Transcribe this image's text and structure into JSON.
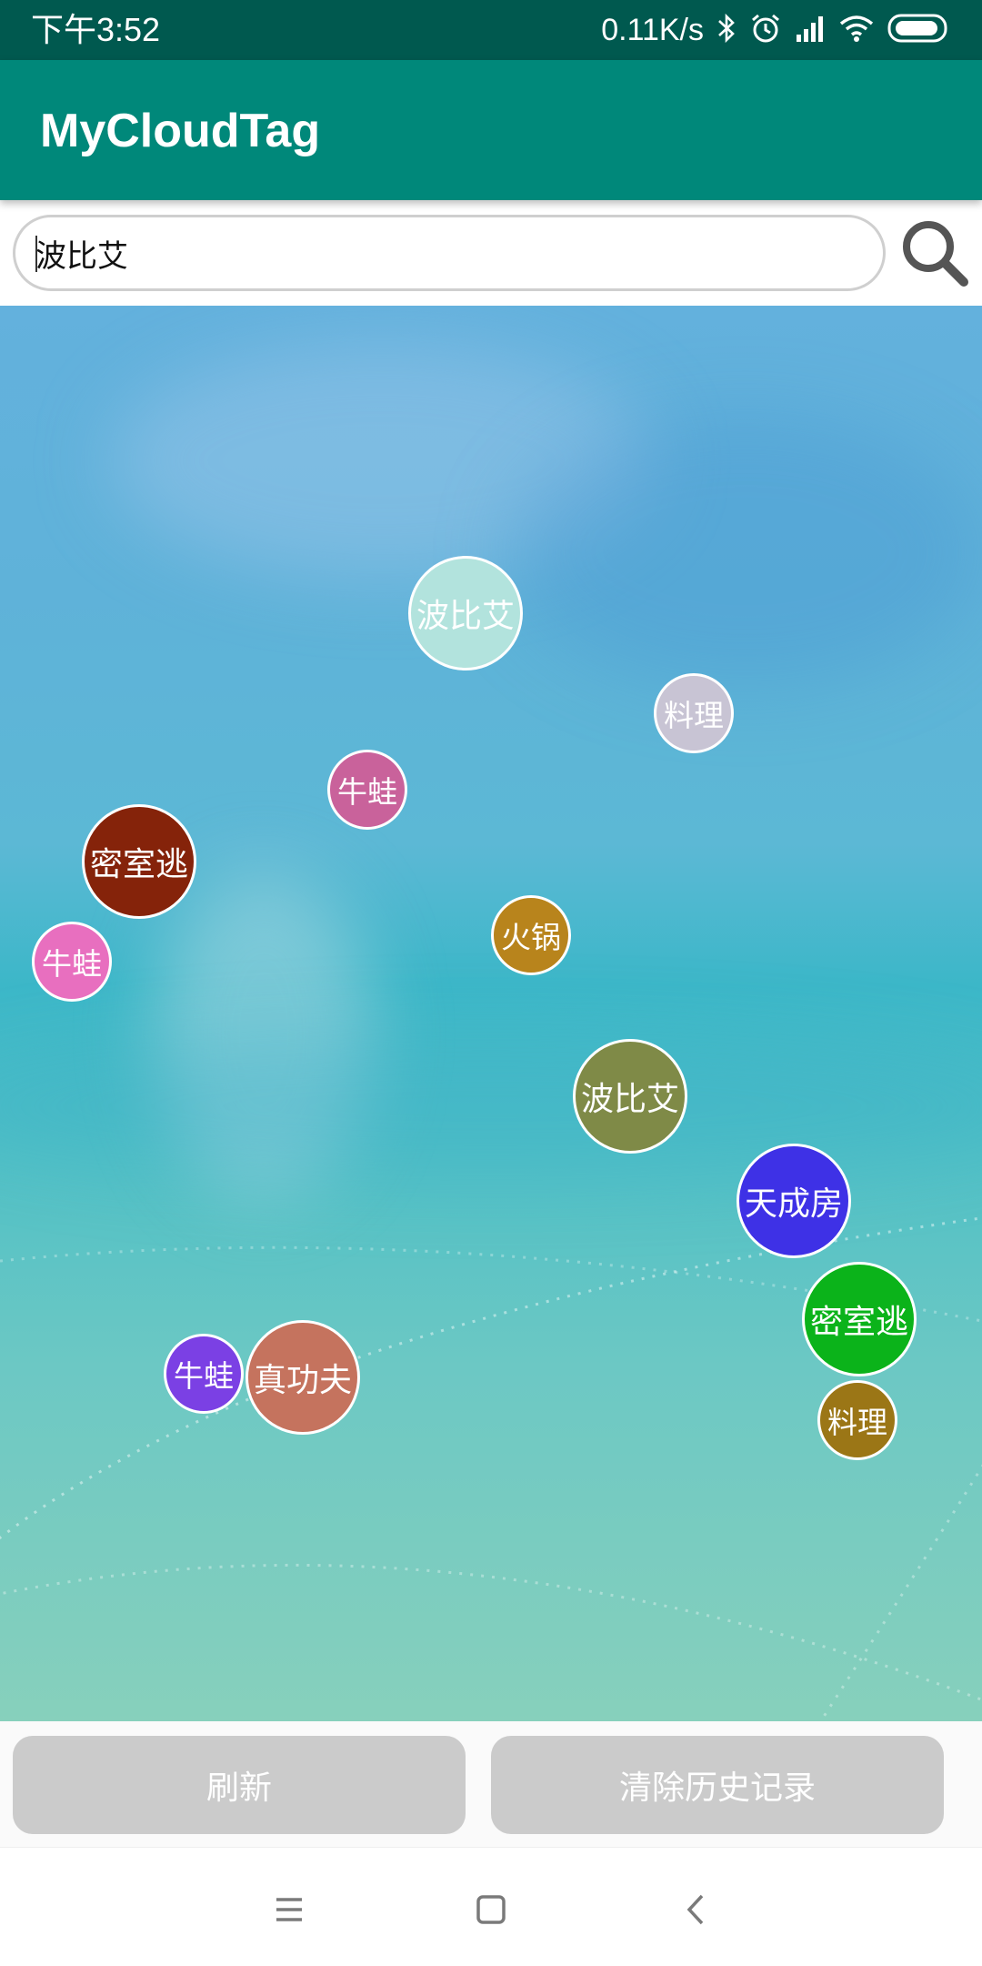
{
  "status_bar": {
    "time": "下午3:52",
    "net_speed": "0.11K/s",
    "icons": [
      "bluetooth-icon",
      "alarm-icon",
      "signal-icon",
      "wifi-icon",
      "battery-icon"
    ]
  },
  "app_bar": {
    "title": "MyCloudTag"
  },
  "search": {
    "value": "波比艾",
    "icon": "search-icon"
  },
  "tags": [
    {
      "label": "波比艾",
      "color": "#b2e3dd"
    },
    {
      "label": "料理",
      "color": "#c8c4d4"
    },
    {
      "label": "牛蛙",
      "color": "#c9629b"
    },
    {
      "label": "密室逃",
      "color": "#85230a"
    },
    {
      "label": "牛蛙",
      "color": "#e86fbf"
    },
    {
      "label": "火锅",
      "color": "#b8841c"
    },
    {
      "label": "波比艾",
      "color": "#7f8a47"
    },
    {
      "label": "天成房",
      "color": "#3e31e6"
    },
    {
      "label": "密室逃",
      "color": "#0bb31a"
    },
    {
      "label": "牛蛙",
      "color": "#7b40e4"
    },
    {
      "label": "真功夫",
      "color": "#c5735e"
    },
    {
      "label": "料理",
      "color": "#9b7616"
    }
  ],
  "buttons": {
    "refresh": "刷新",
    "clear_history": "清除历史记录"
  },
  "nav": {
    "icons": [
      "menu-icon",
      "home-icon",
      "back-icon"
    ]
  },
  "colors": {
    "status_bar": "#00594f",
    "app_bar": "#00887a",
    "button_bg": "#cbcbcb"
  }
}
